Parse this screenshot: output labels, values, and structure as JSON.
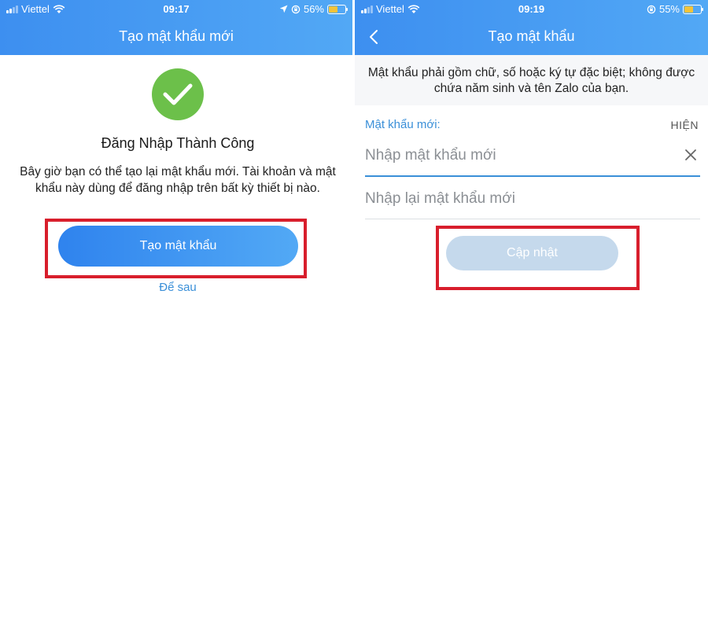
{
  "left_screen": {
    "status_bar": {
      "carrier": "Viettel",
      "time": "09:17",
      "battery": "56%",
      "battery_level": 0.56,
      "icons": [
        "signal-icon",
        "wifi-icon",
        "location-icon",
        "orientation-lock-icon",
        "battery-icon"
      ]
    },
    "header": {
      "title": "Tạo mật khẩu mới"
    },
    "success_icon": "check-icon",
    "success_color": "#6cc04a",
    "success_title": "Đăng Nhập Thành Công",
    "info_text": "Bây giờ bạn có thể tạo lại mật khẩu mới. Tài khoản và mật khẩu này dùng để đăng nhập trên bất kỳ thiết bị nào.",
    "create_button_label": "Tạo mật khẩu",
    "later_link_label": "Để sau"
  },
  "right_screen": {
    "status_bar": {
      "carrier": "Viettel",
      "time": "09:19",
      "battery": "55%",
      "battery_level": 0.55,
      "icons": [
        "signal-icon",
        "wifi-icon",
        "orientation-lock-icon",
        "battery-icon"
      ]
    },
    "header": {
      "title": "Tạo mật khẩu",
      "back_icon": "chevron-left-icon"
    },
    "notice_text": "Mật khẩu phải gồm chữ, số hoặc ký tự đặc biệt; không được chứa năm sinh và tên Zalo của bạn.",
    "new_password": {
      "label": "Mật khẩu mới:",
      "toggle_label": "HIỆN",
      "placeholder": "Nhập mật khẩu mới",
      "value": "",
      "clear_icon": "close-icon"
    },
    "confirm_password": {
      "placeholder": "Nhập lại mật khẩu mới",
      "value": ""
    },
    "update_button_label": "Cập nhật"
  },
  "colors": {
    "header_gradient_start": "#3d8ff0",
    "header_gradient_end": "#52a8f5",
    "accent": "#3a8fd8",
    "highlight_border": "#d81e2c",
    "disabled_button": "#c5d9ec"
  }
}
